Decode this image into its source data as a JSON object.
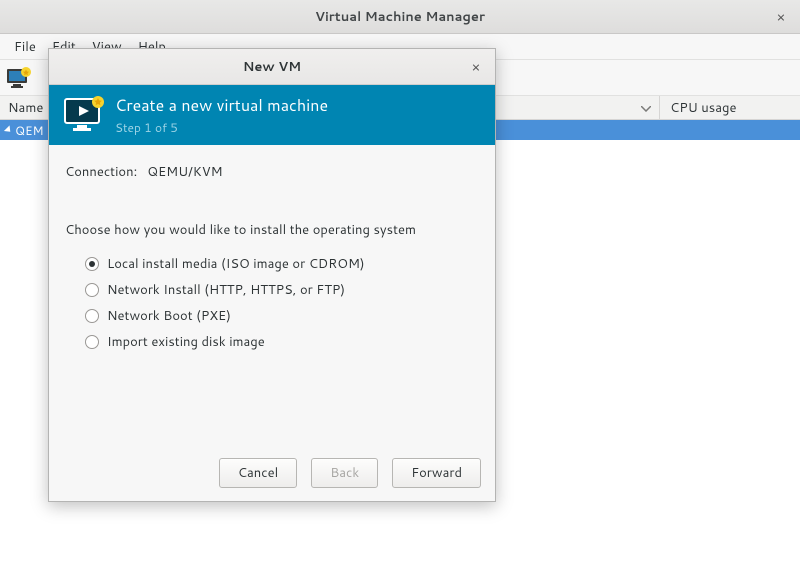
{
  "window": {
    "title": "Virtual Machine Manager"
  },
  "menubar": {
    "file": "File",
    "edit": "Edit",
    "view": "View",
    "help": "Help"
  },
  "columns": {
    "name": "Name",
    "cpu": "CPU usage"
  },
  "tree": {
    "conn_label_prefix": "QEM"
  },
  "dialog": {
    "title": "New VM",
    "header_title": "Create a new virtual machine",
    "step": "Step 1 of 5",
    "connection_label": "Connection:",
    "connection_value": "QEMU/KVM",
    "choose_label": "Choose how you would like to install the operating system",
    "options": {
      "local": "Local install media (ISO image or CDROM)",
      "network_install": "Network Install (HTTP, HTTPS, or FTP)",
      "network_boot": "Network Boot (PXE)",
      "import": "Import existing disk image"
    },
    "selected": "local",
    "buttons": {
      "cancel": "Cancel",
      "back": "Back",
      "forward": "Forward"
    }
  }
}
